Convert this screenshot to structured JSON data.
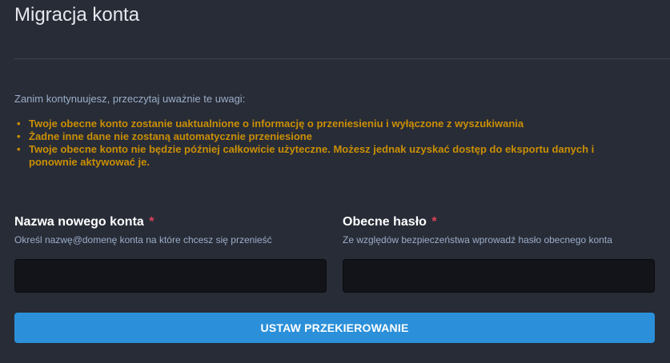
{
  "page": {
    "title": "Migracja konta"
  },
  "notice": {
    "intro": "Zanim kontynuujesz, przeczytaj uważnie te uwagi:",
    "bullet_char": "•",
    "items": [
      "Twoje obecne konto zostanie uaktualnione o informację o przeniesieniu i wyłączone z wyszukiwania",
      "Żadne inne dane nie zostaną automatycznie przeniesione",
      "Twoje obecne konto nie będzie później całkowicie użyteczne. Możesz jednak uzyskać dostęp do eksportu danych i ponownie aktywować je."
    ]
  },
  "form": {
    "new_account": {
      "label": "Nazwa nowego konta",
      "required_mark": "*",
      "hint": "Określ nazwę@domenę konta na które chcesz się przenieść",
      "value": ""
    },
    "current_password": {
      "label": "Obecne hasło",
      "required_mark": "*",
      "hint": "Ze względów bezpieczeństwa wprowadź hasło obecnego konta",
      "value": ""
    },
    "submit_label": "USTAW PRZEKIEROWANIE"
  },
  "colors": {
    "background": "#282c37",
    "warning": "#ca8f04",
    "required": "#df405a",
    "button": "#2b90d9",
    "input_bg": "#131419"
  }
}
